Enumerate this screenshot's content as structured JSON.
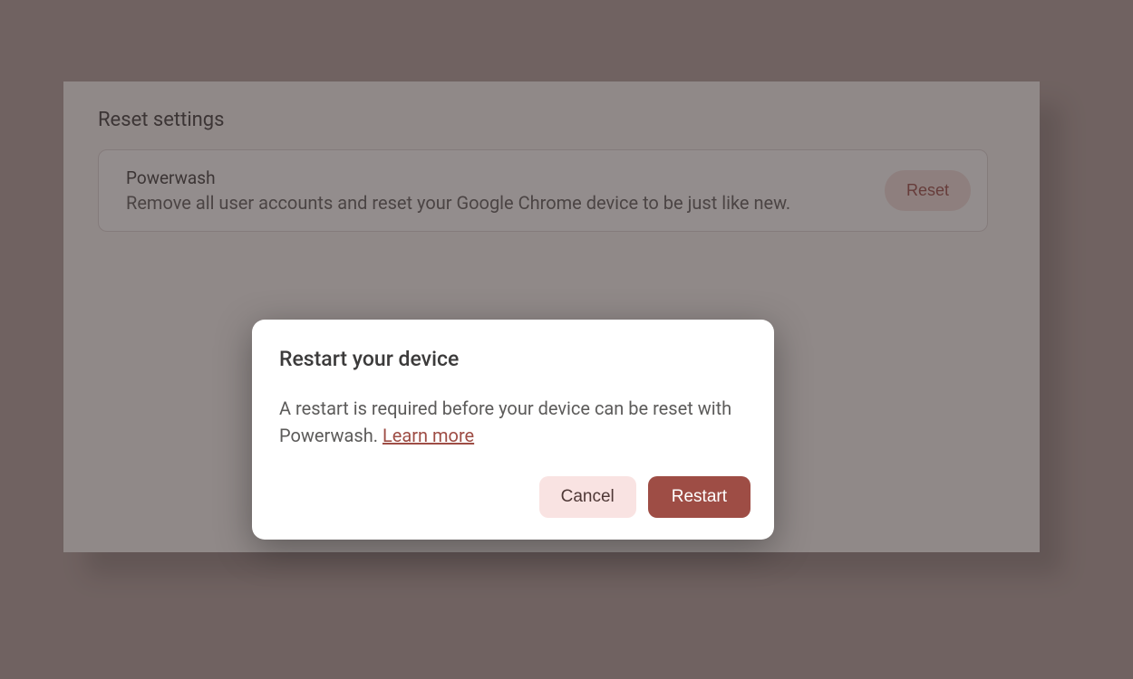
{
  "panel": {
    "heading": "Reset settings",
    "powerwash": {
      "title": "Powerwash",
      "description": "Remove all user accounts and reset your Google Chrome device to be just like new.",
      "button": "Reset"
    }
  },
  "dialog": {
    "title": "Restart your device",
    "body_pre_link": "A restart is required before your device can be reset with Powerwash. ",
    "learn_more": "Learn more",
    "cancel": "Cancel",
    "restart": "Restart"
  },
  "colors": {
    "accent": "#9e4d45",
    "accent_light": "#f9e3e2",
    "background": "#af9e9b"
  }
}
